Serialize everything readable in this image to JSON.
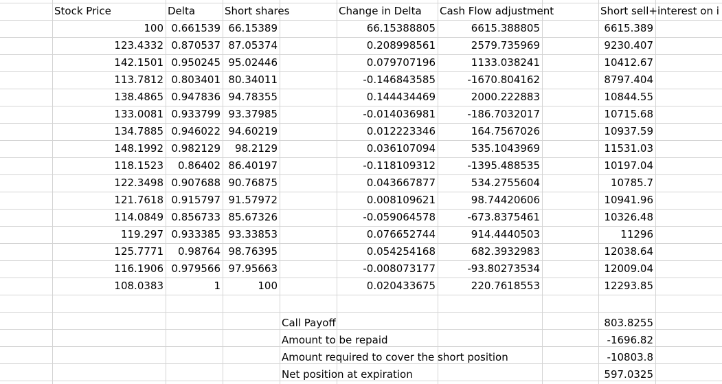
{
  "header": {
    "stock_price": "Stock Price",
    "delta": "Delta",
    "short_shares": "Short shares",
    "change_in_delta": "Change in Delta",
    "cash_flow": "Cash Flow adjustment",
    "short_sell": "Short sell+interest on i"
  },
  "rows": [
    [
      "100",
      "0.661539",
      "66.15389",
      "66.15388805",
      "6615.388805",
      "6615.389"
    ],
    [
      "123.4332",
      "0.870537",
      "87.05374",
      "0.208998561",
      "2579.735969",
      "9230.407"
    ],
    [
      "142.1501",
      "0.950245",
      "95.02446",
      "0.079707196",
      "1133.038241",
      "10412.67"
    ],
    [
      "113.7812",
      "0.803401",
      "80.34011",
      "-0.146843585",
      "-1670.804162",
      "8797.404"
    ],
    [
      "138.4865",
      "0.947836",
      "94.78355",
      "0.144434469",
      "2000.222883",
      "10844.55"
    ],
    [
      "133.0081",
      "0.933799",
      "93.37985",
      "-0.014036981",
      "-186.7032017",
      "10715.68"
    ],
    [
      "134.7885",
      "0.946022",
      "94.60219",
      "0.012223346",
      "164.7567026",
      "10937.59"
    ],
    [
      "148.1992",
      "0.982129",
      "98.2129",
      "0.036107094",
      "535.1043969",
      "11531.03"
    ],
    [
      "118.1523",
      "0.86402",
      "86.40197",
      "-0.118109312",
      "-1395.488535",
      "10197.04"
    ],
    [
      "122.3498",
      "0.907688",
      "90.76875",
      "0.043667877",
      "534.2755604",
      "10785.7"
    ],
    [
      "121.7618",
      "0.915797",
      "91.57972",
      "0.008109621",
      "98.74420606",
      "10941.96"
    ],
    [
      "114.0849",
      "0.856733",
      "85.67326",
      "-0.059064578",
      "-673.8375461",
      "10326.48"
    ],
    [
      "119.297",
      "0.933385",
      "93.33853",
      "0.076652744",
      "914.4440503",
      "11296"
    ],
    [
      "125.7771",
      "0.98764",
      "98.76395",
      "0.054254168",
      "682.3932983",
      "12038.64"
    ],
    [
      "116.1906",
      "0.979566",
      "97.95663",
      "-0.008073177",
      "-93.80273534",
      "12009.04"
    ],
    [
      "108.0383",
      "1",
      "100",
      "0.020433675",
      "220.7618553",
      "12293.85"
    ]
  ],
  "summary": [
    {
      "label": "Call Payoff",
      "value": "803.8255"
    },
    {
      "label": "Amount to be repaid",
      "value": "-1696.82"
    },
    {
      "label": "Amount required to cover the short position",
      "value": "-10803.8"
    },
    {
      "label": "Net position at expiration",
      "value": "597.0325"
    }
  ]
}
